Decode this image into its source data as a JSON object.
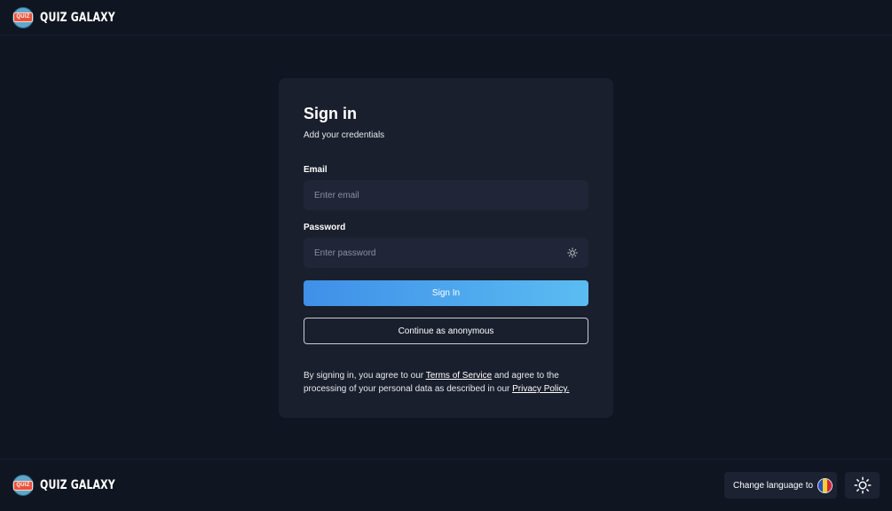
{
  "header": {
    "logo_badge": "QUIZ",
    "brand_name": "QUIZ GALAXY"
  },
  "signin": {
    "title": "Sign in",
    "subtitle": "Add your credentials",
    "email_label": "Email",
    "email_placeholder": "Enter email",
    "email_value": "",
    "password_label": "Password",
    "password_placeholder": "Enter password",
    "password_value": "",
    "password_toggle_icon": "sun-icon",
    "submit_label": "Sign In",
    "anonymous_label": "Continue as anonymous",
    "legal": {
      "part1": "By signing in, you agree to our ",
      "terms_link": "Terms of Service",
      "part2": " and agree to the processing of your personal data as described in our ",
      "privacy_link": "Privacy Policy."
    }
  },
  "footer": {
    "logo_badge": "QUIZ",
    "brand_name": "QUIZ GALAXY",
    "change_language_label": "Change language to",
    "language_flag_colors": [
      "#2a4fc2",
      "#f3d12a",
      "#d7263d"
    ],
    "theme_toggle_icon": "sun-icon"
  },
  "colors": {
    "background": "#101522",
    "card": "#1a1f2d",
    "input": "#202637",
    "primary_start": "#3f8fe8",
    "primary_end": "#5bbcf2"
  }
}
